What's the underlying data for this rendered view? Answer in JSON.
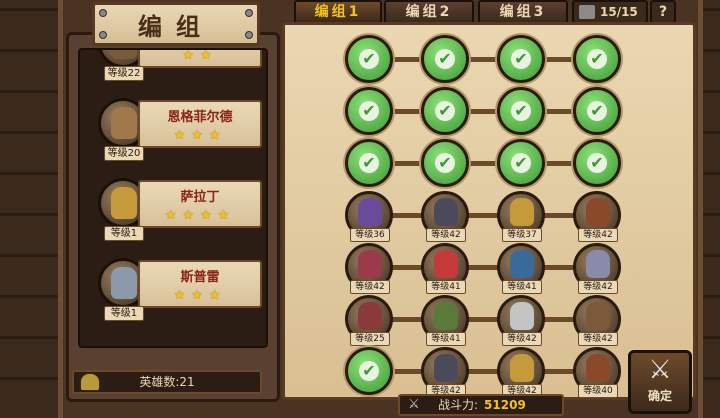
{
  "title": "编组",
  "tabs": [
    {
      "label": "编组1",
      "active": true
    },
    {
      "label": "编组2",
      "active": false
    },
    {
      "label": "编组3",
      "active": false
    }
  ],
  "troop_count": "15/15",
  "help_label": "?",
  "hero_list": [
    {
      "name": "",
      "level": "等级22",
      "stars": "★★"
    },
    {
      "name": "恩格菲尔德",
      "level": "等级20",
      "stars": "★★★"
    },
    {
      "name": "萨拉丁",
      "level": "等级1",
      "stars": "★★★★"
    },
    {
      "name": "斯普雷",
      "level": "等级1",
      "stars": "★★★"
    }
  ],
  "hero_count": "英雄数:21",
  "grid": [
    [
      "empty",
      "empty",
      "empty",
      "empty"
    ],
    [
      "empty",
      "empty",
      "empty",
      "empty"
    ],
    [
      "empty",
      "empty",
      "empty",
      "empty"
    ],
    [
      "等级36",
      "等级42",
      "等级37",
      "等级42"
    ],
    [
      "等级42",
      "等级41",
      "等级41",
      "等级42"
    ],
    [
      "等级25",
      "等级41",
      "等级42",
      "等级42"
    ],
    [
      "empty",
      "等级42",
      "等级42",
      "等级40"
    ]
  ],
  "power_label": "战斗力:",
  "power_value": "51209",
  "confirm_label": "确定",
  "colors": {
    "accent_gold": "#f5c21b",
    "check_green": "#3f9a34",
    "name_red": "#8a2418",
    "parchment": "#ead7b1"
  }
}
